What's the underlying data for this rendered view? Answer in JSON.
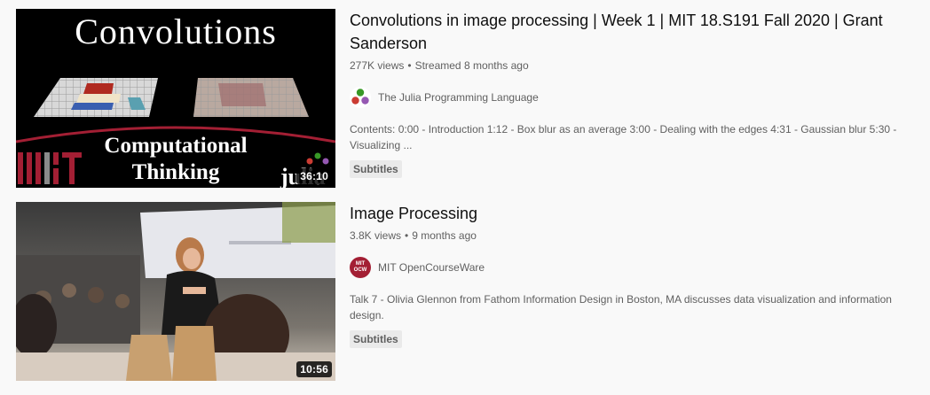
{
  "results": [
    {
      "title": "Convolutions in image processing | Week 1 | MIT 18.S191 Fall 2020 | Grant Sanderson",
      "views": "277K views",
      "age": "Streamed 8 months ago",
      "channel": "The Julia Programming Language",
      "description": "Contents: 0:00 - Introduction 1:12 - Box blur as an average 3:00 - Dealing with the edges 4:31 - Gaussian blur 5:30 - Visualizing ...",
      "badge": "Subtitles",
      "duration": "36:10",
      "thumbnail": {
        "heading": "Convolutions",
        "line1": "Computational",
        "line2": "Thinking",
        "logo_left": "MIT",
        "logo_right": "julia"
      }
    },
    {
      "title": "Image Processing",
      "views": "3.8K views",
      "age": "9 months ago",
      "channel": "MIT OpenCourseWare",
      "channel_avatar_text": "MIT OCW",
      "description": "Talk 7 - Olivia Glennon from Fathom Information Design in Boston, MA discusses data visualization and information design.",
      "badge": "Subtitles",
      "duration": "10:56"
    }
  ],
  "colors": {
    "mit_red": "#a31f34",
    "julia_red": "#cb3c33",
    "julia_green": "#389826",
    "julia_purple": "#9558b2"
  }
}
